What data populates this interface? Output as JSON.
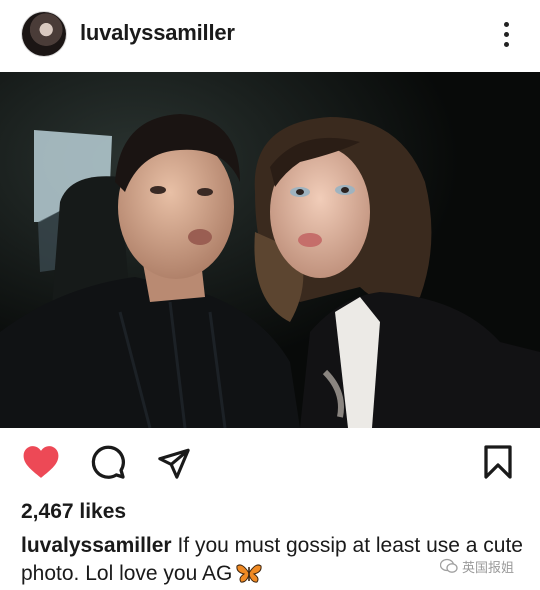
{
  "post": {
    "username": "luvalyssamiller",
    "likes": "2,467 likes",
    "caption_user": "luvalyssamiller",
    "caption_text": "If you must gossip at least use a cute photo. Lol love you AG",
    "caption_emoji": "butterfly-emoji",
    "liked": true
  },
  "icons": {
    "avatar": "profile-avatar",
    "more": "more-options-icon",
    "like": "heart-icon",
    "comment": "comment-icon",
    "share": "share-icon",
    "save": "bookmark-icon",
    "watermark_icon": "wechat-icon"
  },
  "watermark": {
    "text": "英国报姐"
  },
  "colors": {
    "heart": "#ed4956",
    "text": "#1a1a1a",
    "background": "#ffffff"
  }
}
